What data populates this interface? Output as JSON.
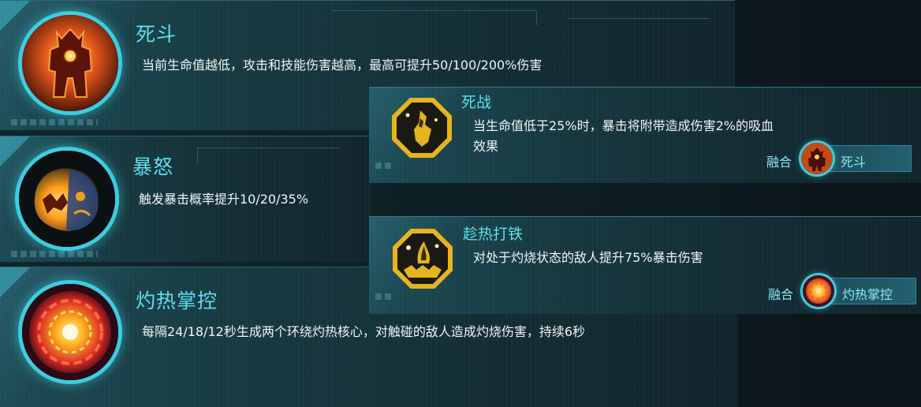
{
  "skills": [
    {
      "title": "死斗",
      "description": "当前生命值越低，攻击和技能伤害越高，最高可提升50/100/200%伤害",
      "icon": "fire-robot-icon"
    },
    {
      "title": "暴怒",
      "description": "触发暴击概率提升10/20/35%",
      "icon": "rage-mask-icon"
    },
    {
      "title": "灼热掌控",
      "description": "每隔24/18/12秒生成两个环绕灼热核心，对触碰的敌人造成灼烧伤害，持续6秒",
      "icon": "fire-core-icon"
    }
  ],
  "fusions": [
    {
      "title": "死战",
      "description_line1": "当生命值低于25%时，暴击将附带造成伤害2%的吸血",
      "description_line2": "效果",
      "fusion_label": "融合",
      "fusion_source": "死斗",
      "icon": "golden-warrior-icon"
    },
    {
      "title": "趁热打铁",
      "description": "对处于灼烧状态的敌人提升75%暴击伤害",
      "fusion_label": "融合",
      "fusion_source": "灼热掌控",
      "icon": "golden-claw-icon"
    }
  ],
  "colors": {
    "title_cyan": "#5fe0ee",
    "ring_cyan": "#3ecde0",
    "gold": "#e6b41e",
    "panel": "#17383f"
  }
}
